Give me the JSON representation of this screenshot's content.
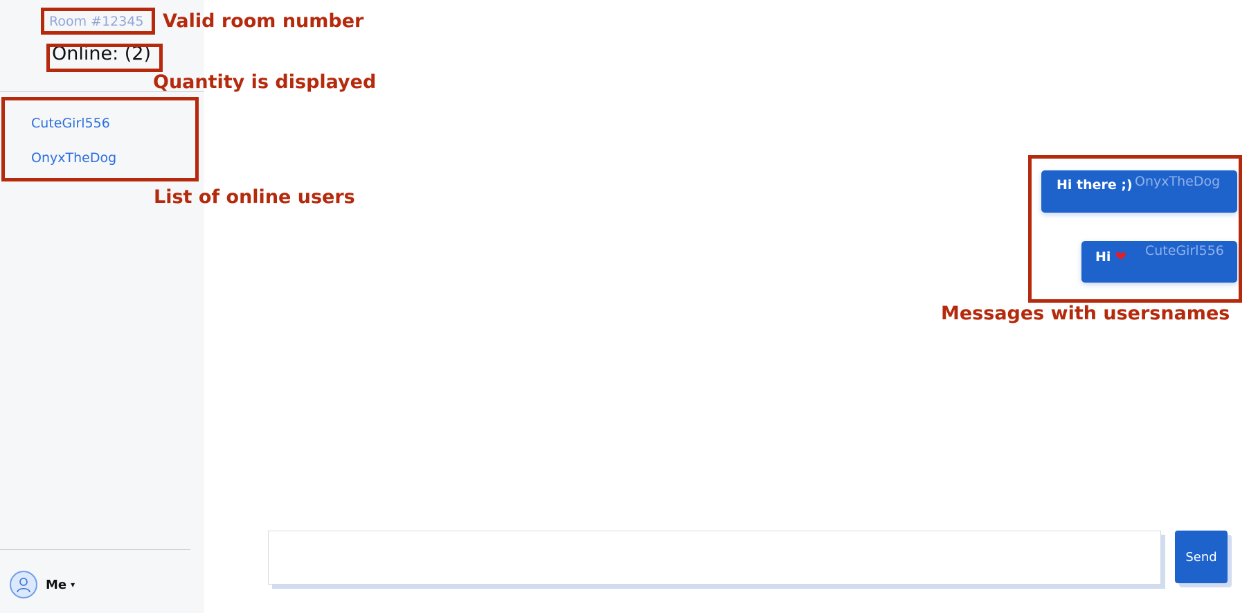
{
  "sidebar": {
    "room_label": "Room #12345",
    "online_label": "Online: (2)",
    "users": [
      {
        "name": "CuteGirl556"
      },
      {
        "name": "OnyxTheDog"
      }
    ],
    "me_label": "Me",
    "caret": "▾",
    "avatar_icon": "user-avatar-icon"
  },
  "chat": {
    "messages": [
      {
        "text": "Hi there ;)",
        "user": "OnyxTheDog"
      },
      {
        "text": "Hi",
        "emoji": "❤",
        "user": "CuteGirl556"
      }
    ]
  },
  "composer": {
    "value": "",
    "send_label": "Send"
  },
  "annotations": {
    "room": "Valid room number",
    "quantity": "Quantity is displayed",
    "users": "List of online users",
    "messages": "Messages with usersnames"
  },
  "colors": {
    "accent": "#1e63cc",
    "annotation": "#b52a0c",
    "sidebar_bg": "#f6f7f9",
    "link": "#2c6fde"
  }
}
